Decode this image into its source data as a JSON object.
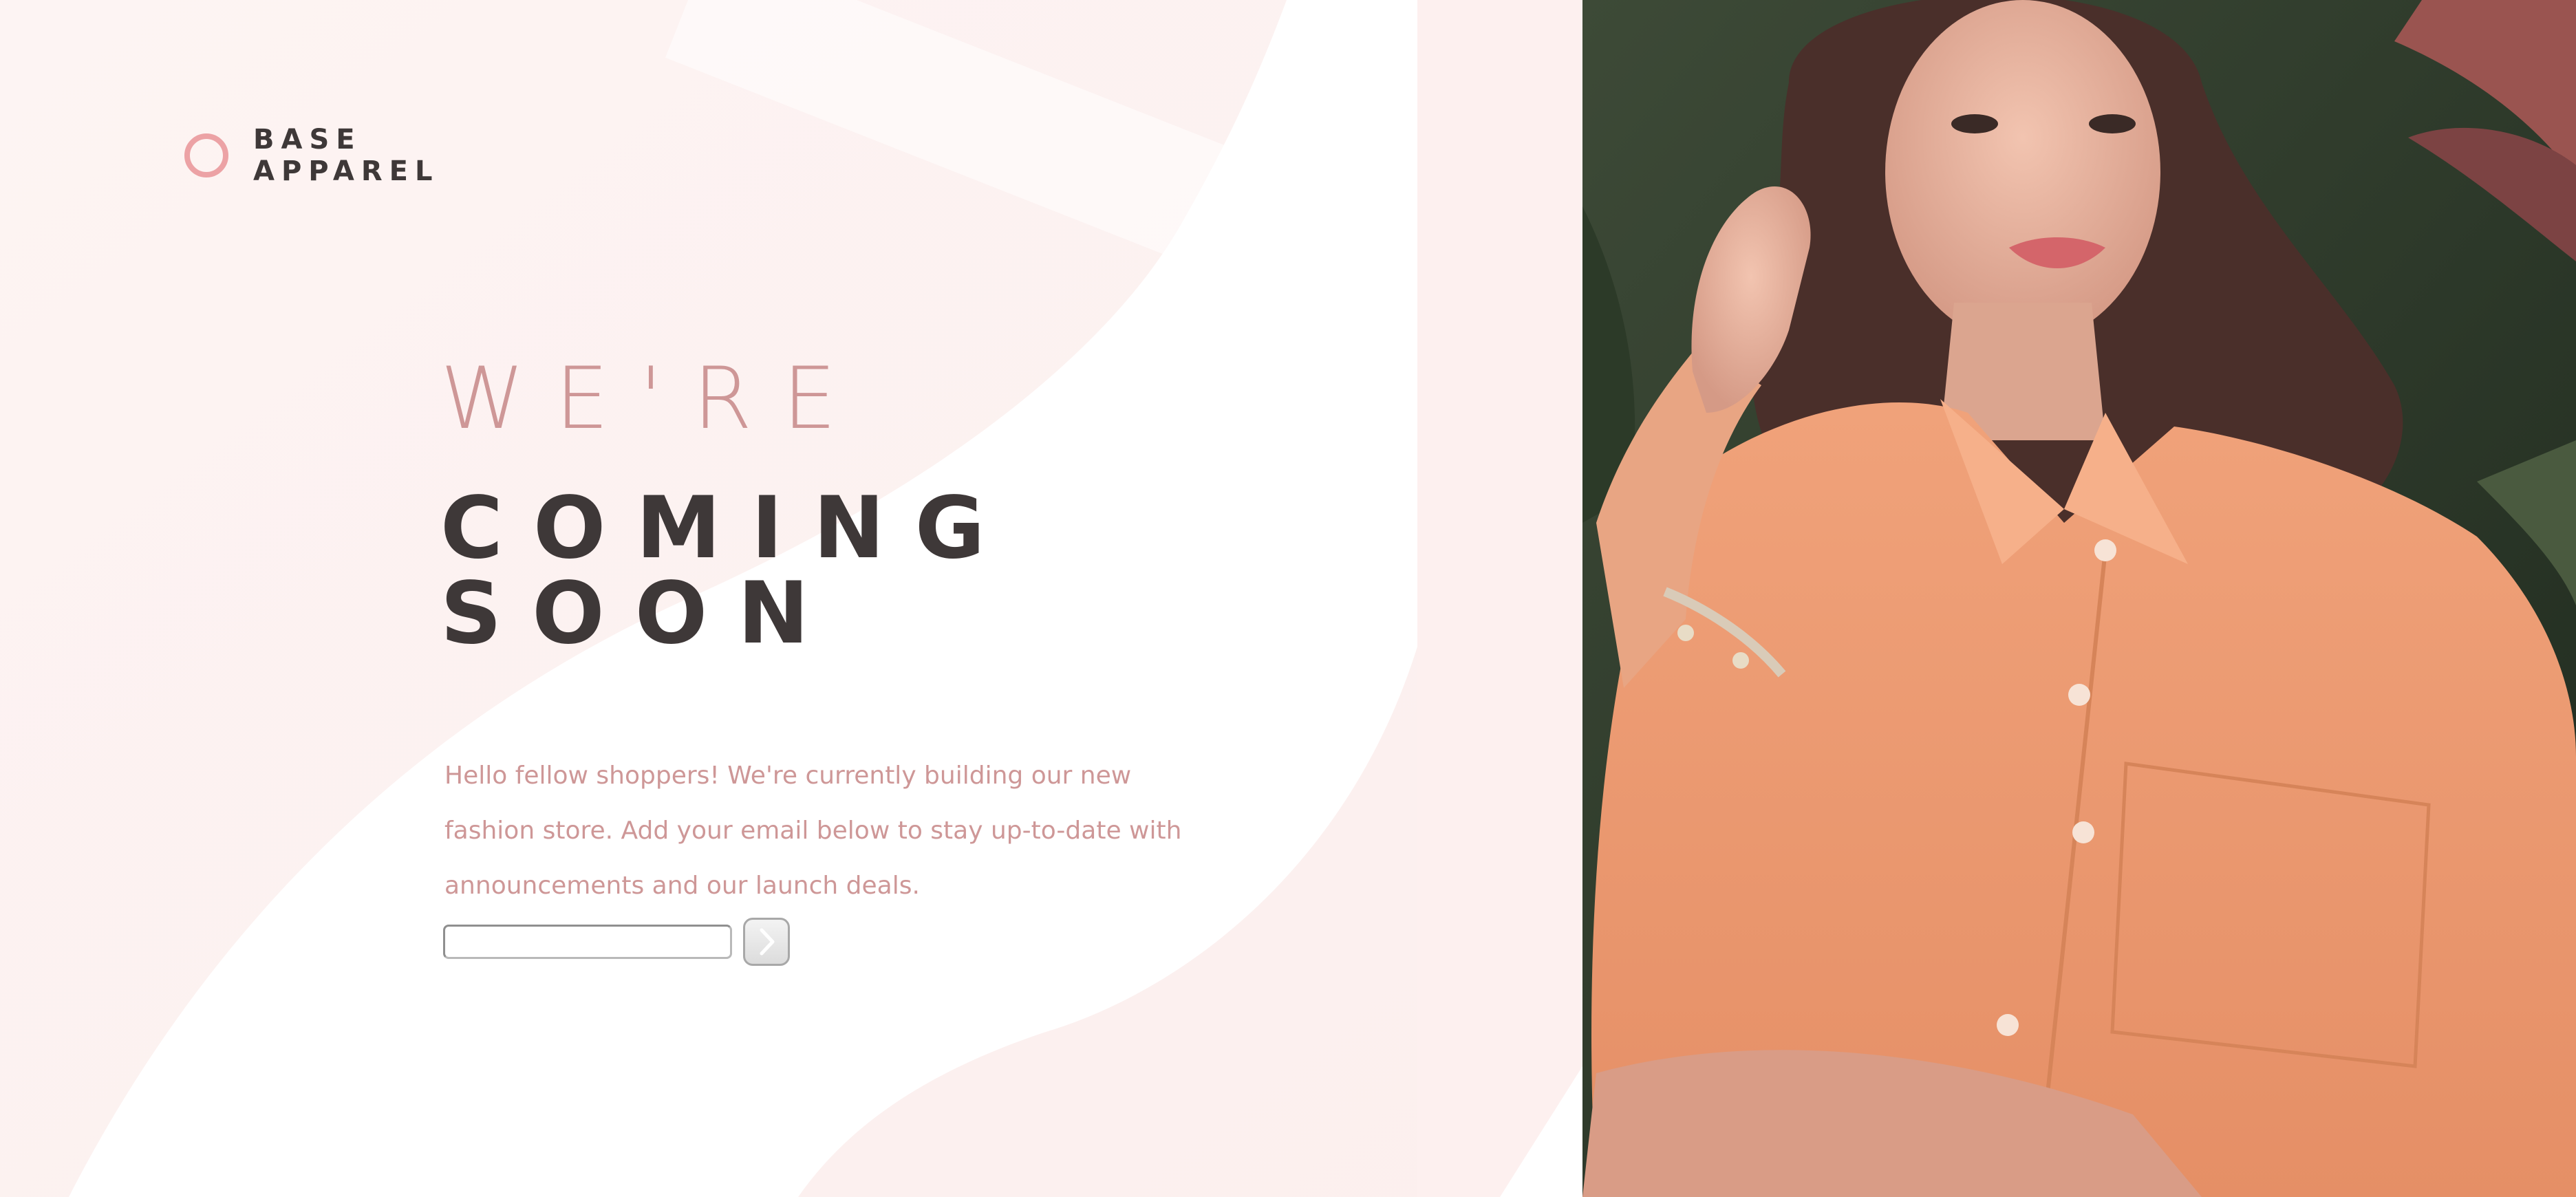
{
  "brand": {
    "name_line1": "BASE",
    "name_line2": "APPAREL"
  },
  "headline": {
    "light": "WE'RE",
    "dark_line1": "COMING",
    "dark_line2": "SOON"
  },
  "description": "Hello fellow shoppers! We're currently building our new fashion store. Add your email below to stay up-to-date with announcements and our launch deals.",
  "form": {
    "email_value": "",
    "submit_icon": "arrow-right-icon"
  },
  "colors": {
    "accent_pink": "#ce9797",
    "dark_text": "#3e3838",
    "logo_ring": "#eca2a5",
    "background": "#fdf4f3"
  },
  "hero": {
    "icon": "hero-model-photo"
  }
}
